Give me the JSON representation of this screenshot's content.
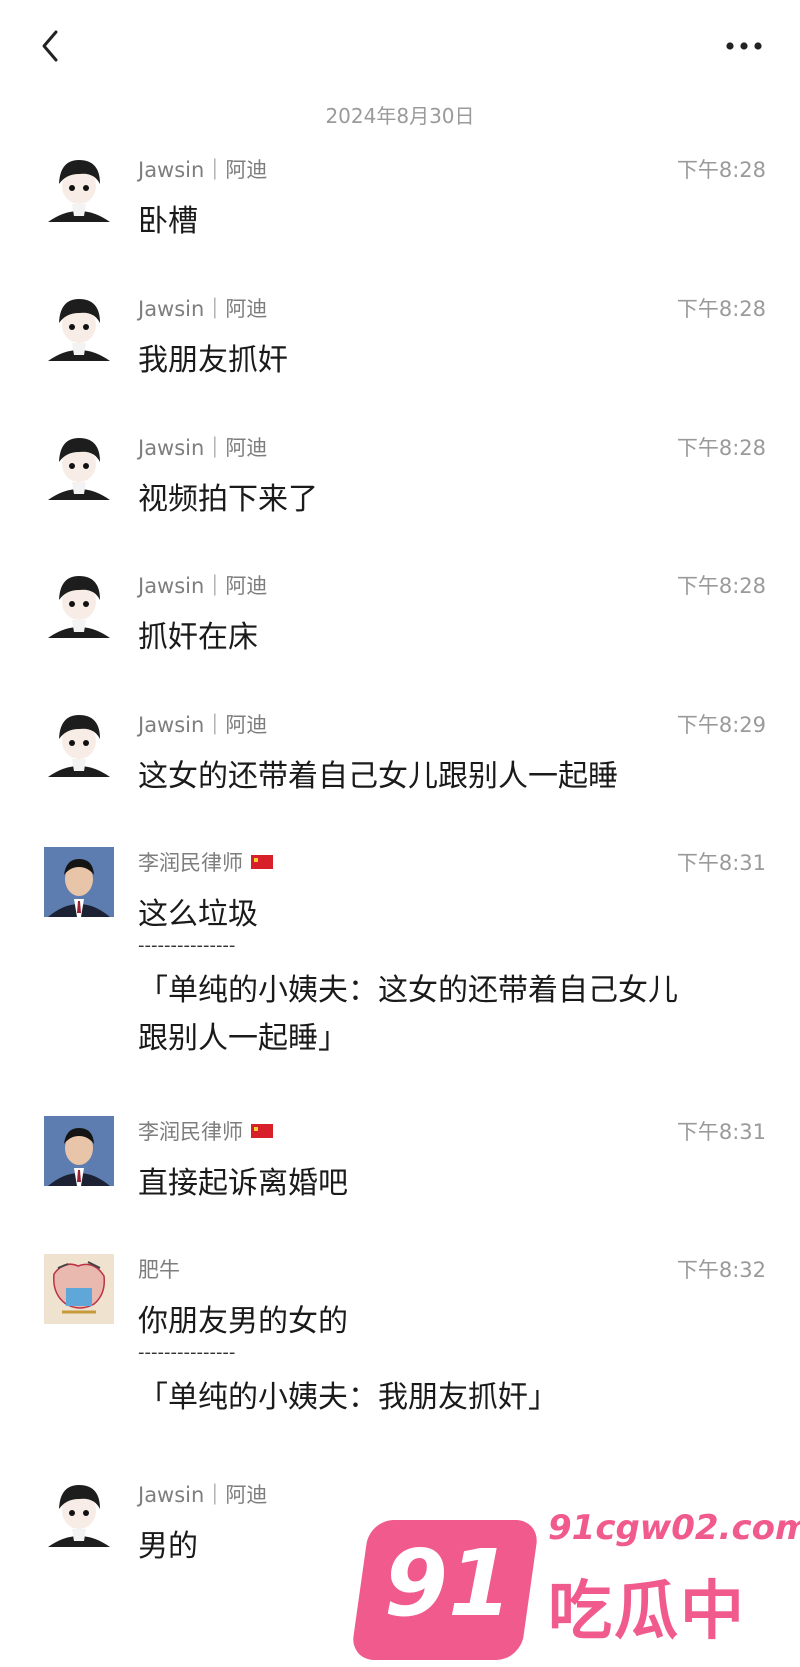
{
  "header": {
    "date": "2024年8月30日"
  },
  "messages": [
    {
      "sender": "Jawsin｜阿迪",
      "time": "下午8:28",
      "text": "卧槽",
      "avatar": "cartoon-boy-avatar"
    },
    {
      "sender": "Jawsin｜阿迪",
      "time": "下午8:28",
      "text": "我朋友抓奸",
      "avatar": "cartoon-boy-avatar"
    },
    {
      "sender": "Jawsin｜阿迪",
      "time": "下午8:28",
      "text": "视频拍下来了",
      "avatar": "cartoon-boy-avatar"
    },
    {
      "sender": "Jawsin｜阿迪",
      "time": "下午8:28",
      "text": "抓奸在床",
      "avatar": "cartoon-boy-avatar"
    },
    {
      "sender": "Jawsin｜阿迪",
      "time": "下午8:29",
      "text": "这女的还带着自己女儿跟别人一起睡",
      "avatar": "cartoon-boy-avatar"
    },
    {
      "sender": "李润民律师",
      "time": "下午8:31",
      "text": "这么垃圾",
      "avatar": "lawyer-photo-avatar",
      "divider": "---------------",
      "quote_line1": "「单纯的小姨夫：这女的还带着自己女儿",
      "quote_line2": "跟别人一起睡」"
    },
    {
      "sender": "李润民律师",
      "time": "下午8:31",
      "text": "直接起诉离婚吧",
      "avatar": "lawyer-photo-avatar"
    },
    {
      "sender": "肥牛",
      "time": "下午8:32",
      "text": "你朋友男的女的",
      "avatar": "sketch-art-avatar",
      "divider": "---------------",
      "quote_line1": "「单纯的小姨夫：我朋友抓奸」"
    },
    {
      "sender": "Jawsin｜阿迪",
      "time": "",
      "text": "男的",
      "avatar": "cartoon-boy-avatar"
    }
  ],
  "watermark": {
    "number": "91",
    "url": "91cgw02.com",
    "title": "吃瓜中心"
  }
}
